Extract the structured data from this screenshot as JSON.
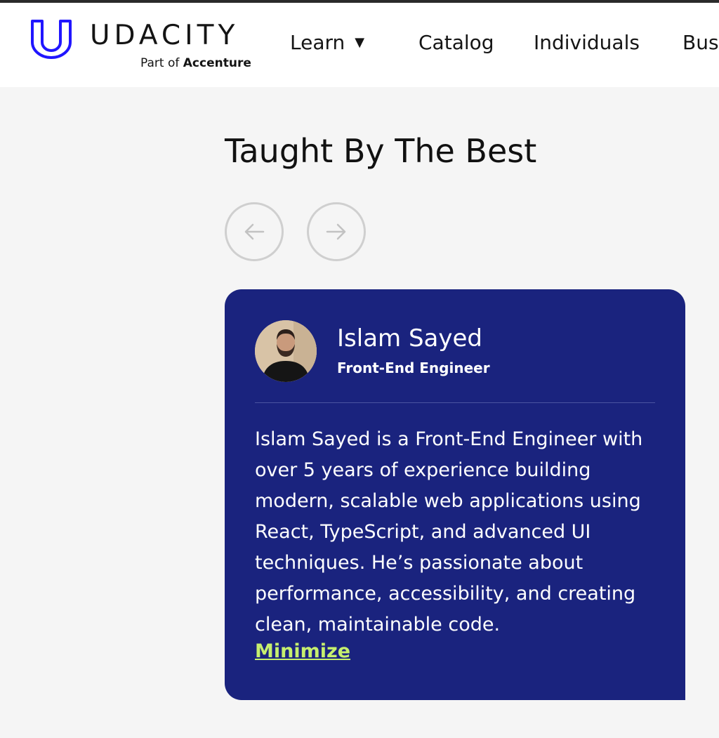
{
  "brand": {
    "name": "UDACITY",
    "tagline_prefix": "Part of",
    "tagline_company": "Accenture",
    "logo_color": "#2015ff"
  },
  "nav": {
    "items": [
      {
        "label": "Learn",
        "has_dropdown": true
      },
      {
        "label": "Catalog"
      },
      {
        "label": "Individuals"
      },
      {
        "label": "Bus"
      }
    ]
  },
  "section": {
    "title": "Taught By The Best",
    "prev_icon": "arrow-left-icon",
    "next_icon": "arrow-right-icon"
  },
  "instructor": {
    "name": "Islam Sayed",
    "role": "Front-End Engineer",
    "bio": "Islam Sayed is a Front-End Engineer with over 5 years of experience building modern, scalable web applications using React, TypeScript, and advanced UI techniques. He’s passionate about performance, accessibility, and creating clean, maintainable code.",
    "toggle_label": "Minimize"
  },
  "colors": {
    "card_bg": "#1a237e",
    "link_accent": "#c6ef6e",
    "page_bg": "#f5f5f5"
  }
}
